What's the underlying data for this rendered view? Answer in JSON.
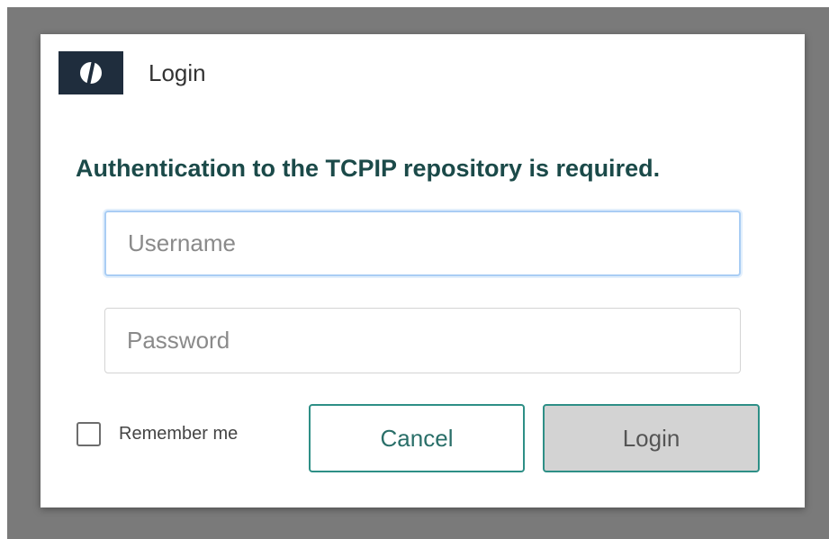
{
  "dialog": {
    "title": "Login",
    "message": "Authentication to the TCPIP repository is required."
  },
  "form": {
    "username": {
      "value": "",
      "placeholder": "Username"
    },
    "password": {
      "value": "",
      "placeholder": "Password"
    },
    "remember_label": "Remember me",
    "remember_checked": false
  },
  "buttons": {
    "cancel_label": "Cancel",
    "login_label": "Login"
  },
  "icons": {
    "logo": "logo-icon"
  },
  "colors": {
    "accent": "#2e8f86",
    "message_text": "#1b4a49",
    "logo_bg": "#1f2d3d",
    "backdrop": "#7a7a7a"
  }
}
